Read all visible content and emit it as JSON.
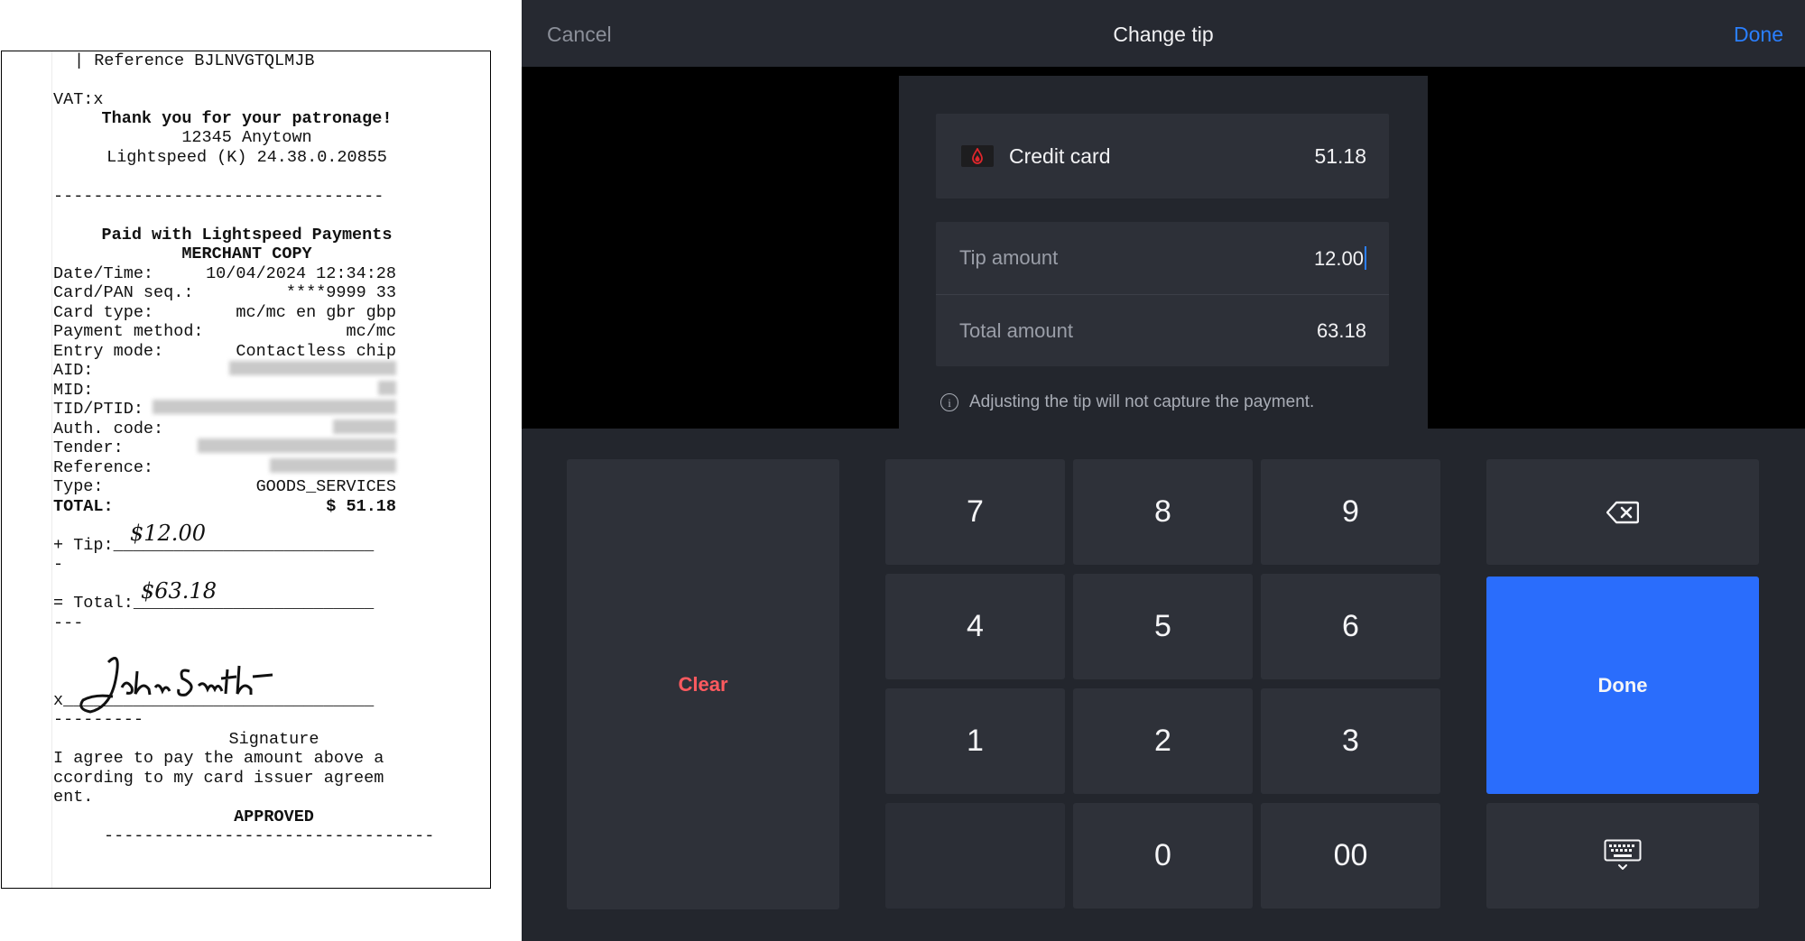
{
  "receipt": {
    "reference_line": "| Reference BJLNVGTQLMJB",
    "vat": "VAT:x",
    "thanks": "Thank you for your patronage!",
    "address": "12345 Anytown",
    "version": "Lightspeed (K) 24.38.0.20855",
    "divider": "---------------------------------",
    "paid_with": "Paid with Lightspeed Payments",
    "copy_type": "MERCHANT COPY",
    "fields": [
      {
        "label": "Date/Time:",
        "value": "10/04/2024 12:34:28"
      },
      {
        "label": "Card/PAN seq.:",
        "value": "****9999 33"
      },
      {
        "label": "Card type:",
        "value": "mc/mc en gbr gbp"
      },
      {
        "label": "Payment method:",
        "value": "mc/mc"
      },
      {
        "label": "Entry mode:",
        "value": "Contactless chip"
      },
      {
        "label": "AID:",
        "value": ""
      },
      {
        "label": "MID:",
        "value": ""
      },
      {
        "label": "TID/PTID:",
        "value": ""
      },
      {
        "label": "Auth. code:",
        "value": ""
      },
      {
        "label": "Tender:",
        "value": ""
      },
      {
        "label": "Reference:",
        "value": ""
      },
      {
        "label": "Type:",
        "value": "GOODS_SERVICES"
      }
    ],
    "total_label": "TOTAL:",
    "total_value": "$ 51.18",
    "tip_line": "+ Tip:__________________________",
    "dash1": "-",
    "total_line": "= Total:________________________",
    "dash2": "---",
    "sig_line": "x_______________________________",
    "dash3": "---------",
    "signature_label": "Signature",
    "agree_1": "I agree to pay the amount above a",
    "agree_2": "ccording to my card issuer agreem",
    "agree_3": "ent.",
    "approved": "APPROVED",
    "bottom_divider": "---------------------------------",
    "handwritten_tip": "$12.00",
    "handwritten_total": "$63.18",
    "signature_text": "John Smith"
  },
  "app": {
    "cancel_label": "Cancel",
    "title": "Change tip",
    "done_label": "Done",
    "payment_method_label": "Credit card",
    "payment_amount": "51.18",
    "tip_label": "Tip amount",
    "tip_value": "12.00",
    "total_label": "Total amount",
    "total_value": "63.18",
    "notice": "Adjusting the tip will not capture the payment.",
    "clear_label": "Clear",
    "done_key_label": "Done",
    "keys": {
      "k7": "7",
      "k8": "8",
      "k9": "9",
      "k4": "4",
      "k5": "5",
      "k6": "6",
      "k1": "1",
      "k2": "2",
      "k3": "3",
      "k0": "0",
      "k00": "00"
    },
    "accent_color": "#2a6dfc",
    "clear_color": "#ff5a5f",
    "icons": {
      "backspace": "backspace-icon",
      "keyboard": "keyboard-hide-icon",
      "info": "info-icon",
      "logo": "lightspeed-logo-icon"
    }
  }
}
